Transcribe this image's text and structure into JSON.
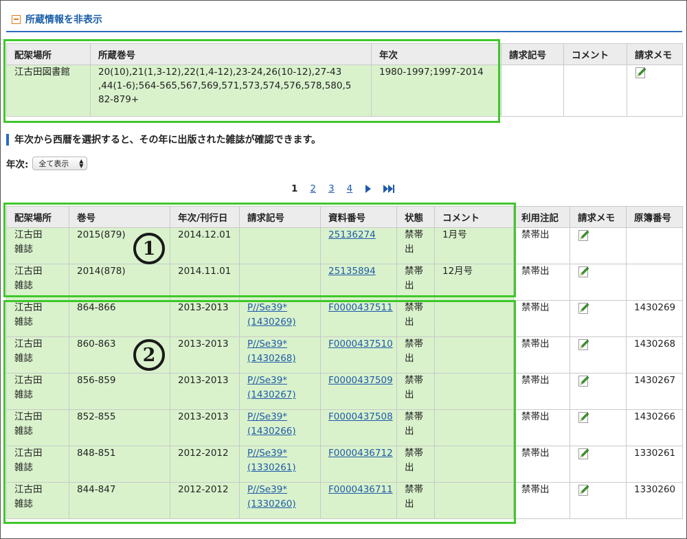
{
  "toggle_label": "所蔵情報を非表示",
  "holdings": {
    "headers": [
      "配架場所",
      "所蔵巻号",
      "年次",
      "請求記号",
      "コメント",
      "請求メモ"
    ],
    "row": {
      "location": "江古田図書館",
      "volumes_line1": "20(10),21(1,3-12),22(1,4-12),23-24,26(10-12),27-43",
      "volumes_line2": ",44(1-6);564-565,567,569,571,573,574,576,578,580,5",
      "volumes_line3": "82-879+",
      "years": "1980-1997;1997-2014",
      "call_number": "",
      "comment": "",
      "memo_icon": "memo-edit-icon"
    }
  },
  "section_heading": "年次から西暦を選択すると、その年に出版された雑誌が確認できます。",
  "year_filter": {
    "label": "年次:",
    "selected": "全て表示"
  },
  "pagination": {
    "current": "1",
    "pages": [
      "2",
      "3",
      "4"
    ]
  },
  "annotations": {
    "badge1": "1",
    "badge2": "2"
  },
  "list": {
    "headers": [
      "配架場所",
      "巻号",
      "年次/刊行日",
      "請求記号",
      "資料番号",
      "状態",
      "コメント",
      "利用注記",
      "請求メモ",
      "原簿番号"
    ],
    "rows": [
      {
        "loc1": "江古田",
        "loc2": "雑誌",
        "volume": "2015(879)",
        "date": "2014.12.01",
        "call1": "",
        "call2": "",
        "item": "25136274",
        "st1": "禁帯",
        "st2": "出",
        "comment": "1月号",
        "note": "禁帯出",
        "ledger": ""
      },
      {
        "loc1": "江古田",
        "loc2": "雑誌",
        "volume": "2014(878)",
        "date": "2014.11.01",
        "call1": "",
        "call2": "",
        "item": "25135894",
        "st1": "禁帯",
        "st2": "出",
        "comment": "12月号",
        "note": "禁帯出",
        "ledger": ""
      },
      {
        "loc1": "江古田",
        "loc2": "雑誌",
        "volume": "864-866",
        "date": "2013-2013",
        "call1": "P//Se39*",
        "call2": "(1430269)",
        "item": "F0000437511",
        "st1": "禁帯",
        "st2": "出",
        "comment": "",
        "note": "禁帯出",
        "ledger": "1430269"
      },
      {
        "loc1": "江古田",
        "loc2": "雑誌",
        "volume": "860-863",
        "date": "2013-2013",
        "call1": "P//Se39*",
        "call2": "(1430268)",
        "item": "F0000437510",
        "st1": "禁帯",
        "st2": "出",
        "comment": "",
        "note": "禁帯出",
        "ledger": "1430268"
      },
      {
        "loc1": "江古田",
        "loc2": "雑誌",
        "volume": "856-859",
        "date": "2013-2013",
        "call1": "P//Se39*",
        "call2": "(1430267)",
        "item": "F0000437509",
        "st1": "禁帯",
        "st2": "出",
        "comment": "",
        "note": "禁帯出",
        "ledger": "1430267"
      },
      {
        "loc1": "江古田",
        "loc2": "雑誌",
        "volume": "852-855",
        "date": "2013-2013",
        "call1": "P//Se39*",
        "call2": "(1430266)",
        "item": "F0000437508",
        "st1": "禁帯",
        "st2": "出",
        "comment": "",
        "note": "禁帯出",
        "ledger": "1430266"
      },
      {
        "loc1": "江古田",
        "loc2": "雑誌",
        "volume": "848-851",
        "date": "2012-2012",
        "call1": "P//Se39*",
        "call2": "(1330261)",
        "item": "F0000436712",
        "st1": "禁帯",
        "st2": "出",
        "comment": "",
        "note": "禁帯出",
        "ledger": "1330261"
      },
      {
        "loc1": "江古田",
        "loc2": "雑誌",
        "volume": "844-847",
        "date": "2012-2012",
        "call1": "P//Se39*",
        "call2": "(1330260)",
        "item": "F0000436711",
        "st1": "禁帯",
        "st2": "出",
        "comment": "",
        "note": "禁帯出",
        "ledger": "1330260"
      }
    ]
  },
  "colors": {
    "link": "#1f5aa8",
    "highlight_bg": "#d9f2cc",
    "highlight_border": "#3fc72b",
    "header_bg": "#ececec",
    "accent_rule": "#2a6bc0"
  }
}
